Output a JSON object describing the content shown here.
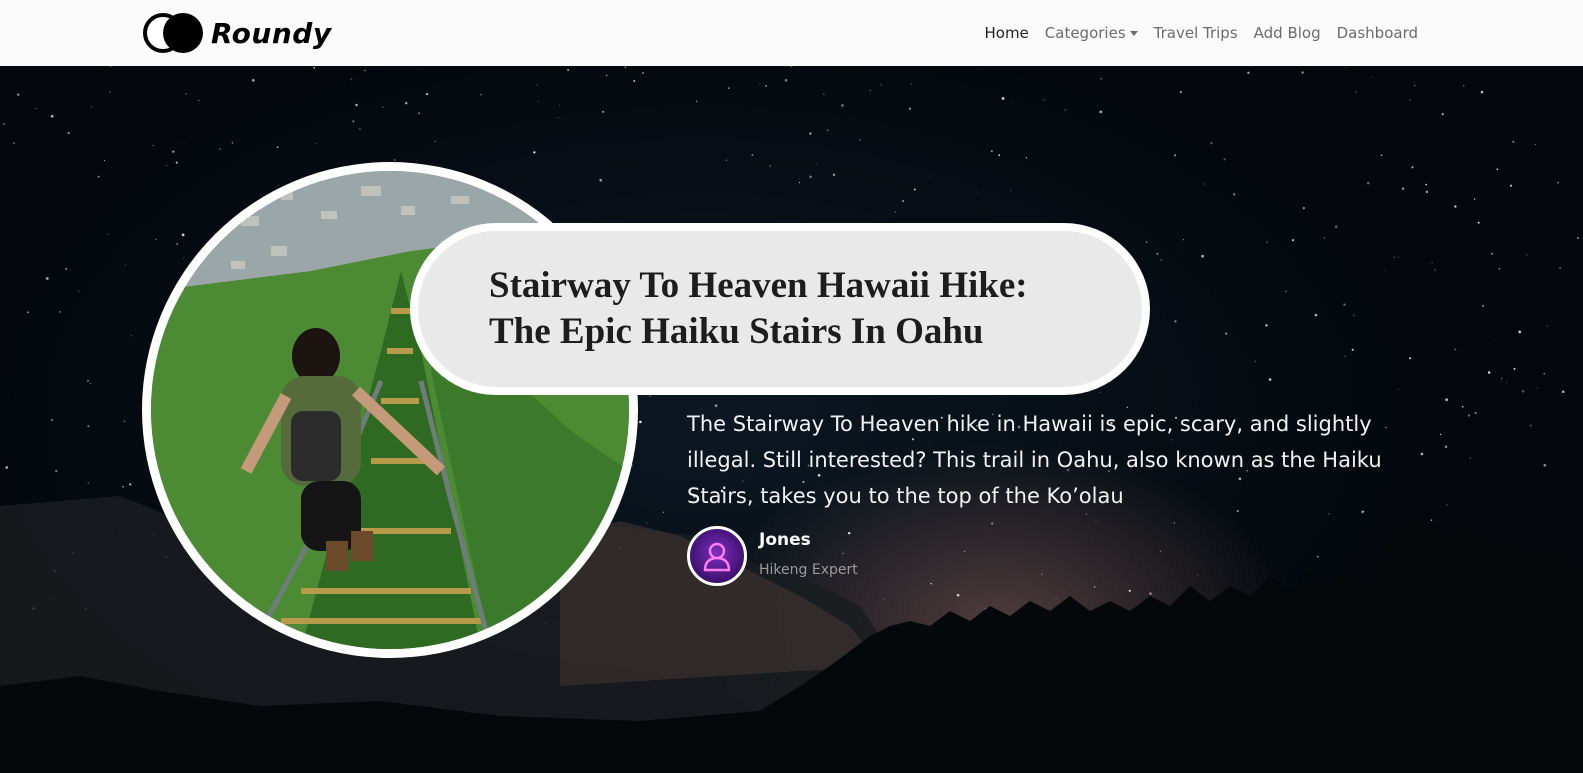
{
  "brand": {
    "name": "Roundy"
  },
  "nav": {
    "items": [
      {
        "label": "Home"
      },
      {
        "label": "Categories"
      },
      {
        "label": "Travel Trips"
      },
      {
        "label": "Add Blog"
      },
      {
        "label": "Dashboard"
      }
    ]
  },
  "hero": {
    "title": "Stairway To Heaven Hawaii Hike: The Epic Haiku Stairs In Oahu",
    "excerpt": "The Stairway To Heaven hike in Hawaii is epic, scary, and slightly illegal. Still interested? This trail in Oahu, also known as the Haiku Stairs, takes you to the top of the Ko’olau",
    "author": {
      "name": "Jones",
      "role": "Hikeng Expert"
    }
  },
  "icons": [
    "logo-icon",
    "caret-down-icon",
    "user-icon"
  ]
}
